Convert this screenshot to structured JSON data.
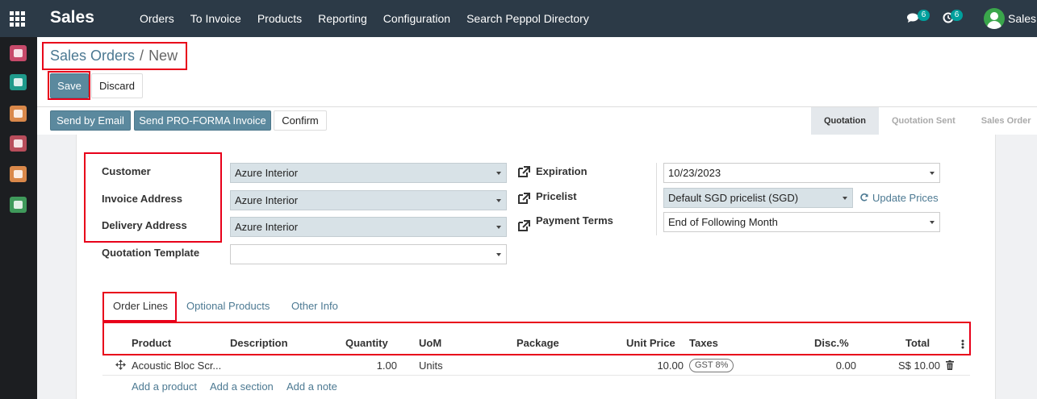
{
  "navbar": {
    "app_name": "Sales",
    "menu": [
      "Orders",
      "To Invoice",
      "Products",
      "Reporting",
      "Configuration",
      "Search Peppol Directory"
    ],
    "messages_count": "6",
    "activities_count": "6",
    "user_name": "Sales"
  },
  "sidebar": {
    "icons": [
      {
        "name": "discuss-icon",
        "color": "#c74a6a"
      },
      {
        "name": "contacts-icon",
        "color": "#1f9a8b"
      },
      {
        "name": "sales-chart-icon",
        "color": "#d9884a"
      },
      {
        "name": "inventory-icon",
        "color": "#b84d5b"
      },
      {
        "name": "invoicing-icon",
        "color": "#d9884a"
      },
      {
        "name": "documents-icon",
        "color": "#3f9a5b"
      }
    ]
  },
  "breadcrumb": {
    "parent": "Sales Orders",
    "separator": "/",
    "current": "New"
  },
  "actions": {
    "save": "Save",
    "discard": "Discard"
  },
  "header_buttons": {
    "send_by_email": "Send by Email",
    "send_proforma": "Send PRO-FORMA Invoice",
    "confirm": "Confirm"
  },
  "statusbar": {
    "stages": [
      "Quotation",
      "Quotation Sent",
      "Sales Order"
    ],
    "active": "Quotation"
  },
  "form": {
    "customer": {
      "label": "Customer",
      "value": "Azure Interior"
    },
    "invoice_address": {
      "label": "Invoice Address",
      "value": "Azure Interior"
    },
    "delivery_address": {
      "label": "Delivery Address",
      "value": "Azure Interior"
    },
    "quotation_template": {
      "label": "Quotation Template",
      "value": ""
    },
    "expiration": {
      "label": "Expiration",
      "value": "10/23/2023"
    },
    "pricelist": {
      "label": "Pricelist",
      "value": "Default SGD pricelist (SGD)"
    },
    "payment_terms": {
      "label": "Payment Terms",
      "value": "End of Following Month"
    },
    "update_prices": "Update Prices"
  },
  "tabs": [
    "Order Lines",
    "Optional Products",
    "Other Info"
  ],
  "order_lines": {
    "columns": [
      "Product",
      "Description",
      "Quantity",
      "UoM",
      "Package",
      "Unit Price",
      "Taxes",
      "Disc.%",
      "Total"
    ],
    "rows": [
      {
        "product": "Acoustic Bloc Scr...",
        "description": "",
        "quantity": "1.00",
        "uom": "Units",
        "package": "",
        "unit_price": "10.00",
        "taxes": "GST 8%",
        "discount": "0.00",
        "total": "S$ 10.00"
      }
    ],
    "add_product": "Add a product",
    "add_section": "Add a section",
    "add_note": "Add a note"
  },
  "colors": {
    "navbar": "#2c3a47",
    "primary": "#5b899e",
    "link": "#4c7992",
    "annotation": "#e8001a",
    "filled_field": "#d8e2e7"
  }
}
